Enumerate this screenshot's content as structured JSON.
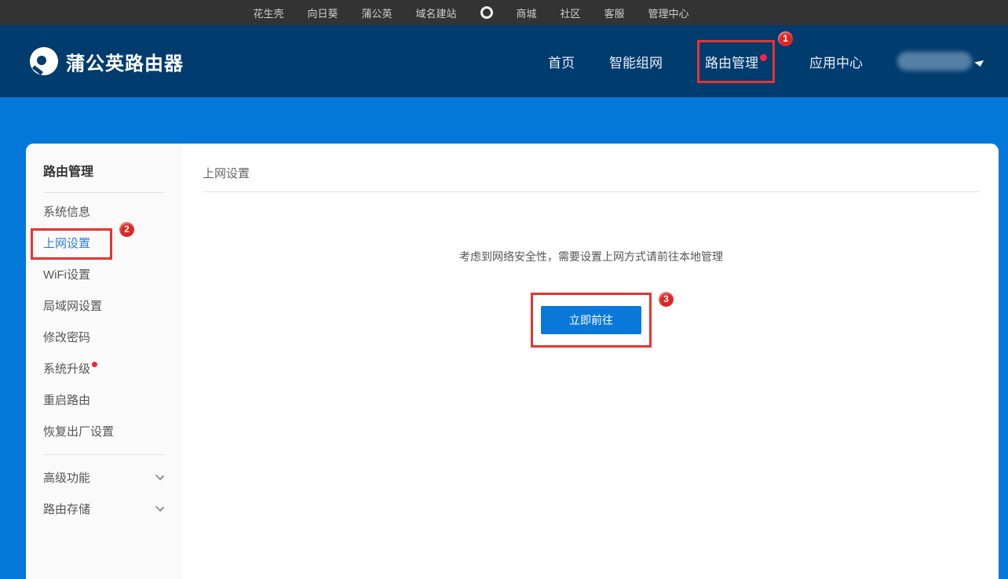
{
  "topbar": {
    "items": [
      "花生壳",
      "向日葵",
      "蒲公英",
      "域名建站",
      "商城",
      "社区",
      "客服",
      "管理中心"
    ]
  },
  "header": {
    "brand": "蒲公英路由器",
    "nav": [
      {
        "label": "首页"
      },
      {
        "label": "智能组网"
      },
      {
        "label": "路由管理",
        "active": true,
        "has_red_dot": true
      },
      {
        "label": "应用中心"
      }
    ],
    "user": {
      "display": "blurred-account-name"
    }
  },
  "sidebar": {
    "title": "路由管理",
    "items": [
      {
        "label": "系统信息"
      },
      {
        "label": "上网设置",
        "active": true
      },
      {
        "label": "WiFi设置"
      },
      {
        "label": "局域网设置"
      },
      {
        "label": "修改密码"
      },
      {
        "label": "系统升级",
        "has_red_dot": true
      },
      {
        "label": "重启路由"
      },
      {
        "label": "恢复出厂设置"
      }
    ],
    "groups": [
      {
        "label": "高级功能"
      },
      {
        "label": "路由存储"
      }
    ]
  },
  "main": {
    "title": "上网设置",
    "message": "考虑到网络安全性，需要设置上网方式请前往本地管理",
    "button_label": "立即前往"
  },
  "annotations": {
    "steps": [
      "1",
      "2",
      "3"
    ]
  },
  "colors": {
    "topbar_bg": "#333333",
    "header_bg": "#013c6e",
    "page_bg": "#0478d8",
    "button_blue": "#0a78d8",
    "active_link_blue": "#3380d0",
    "annotation_red": "#e53430",
    "badge_red": "#dd2626",
    "dot_red": "#f5224d",
    "sidebar_bg": "#fafafa"
  }
}
